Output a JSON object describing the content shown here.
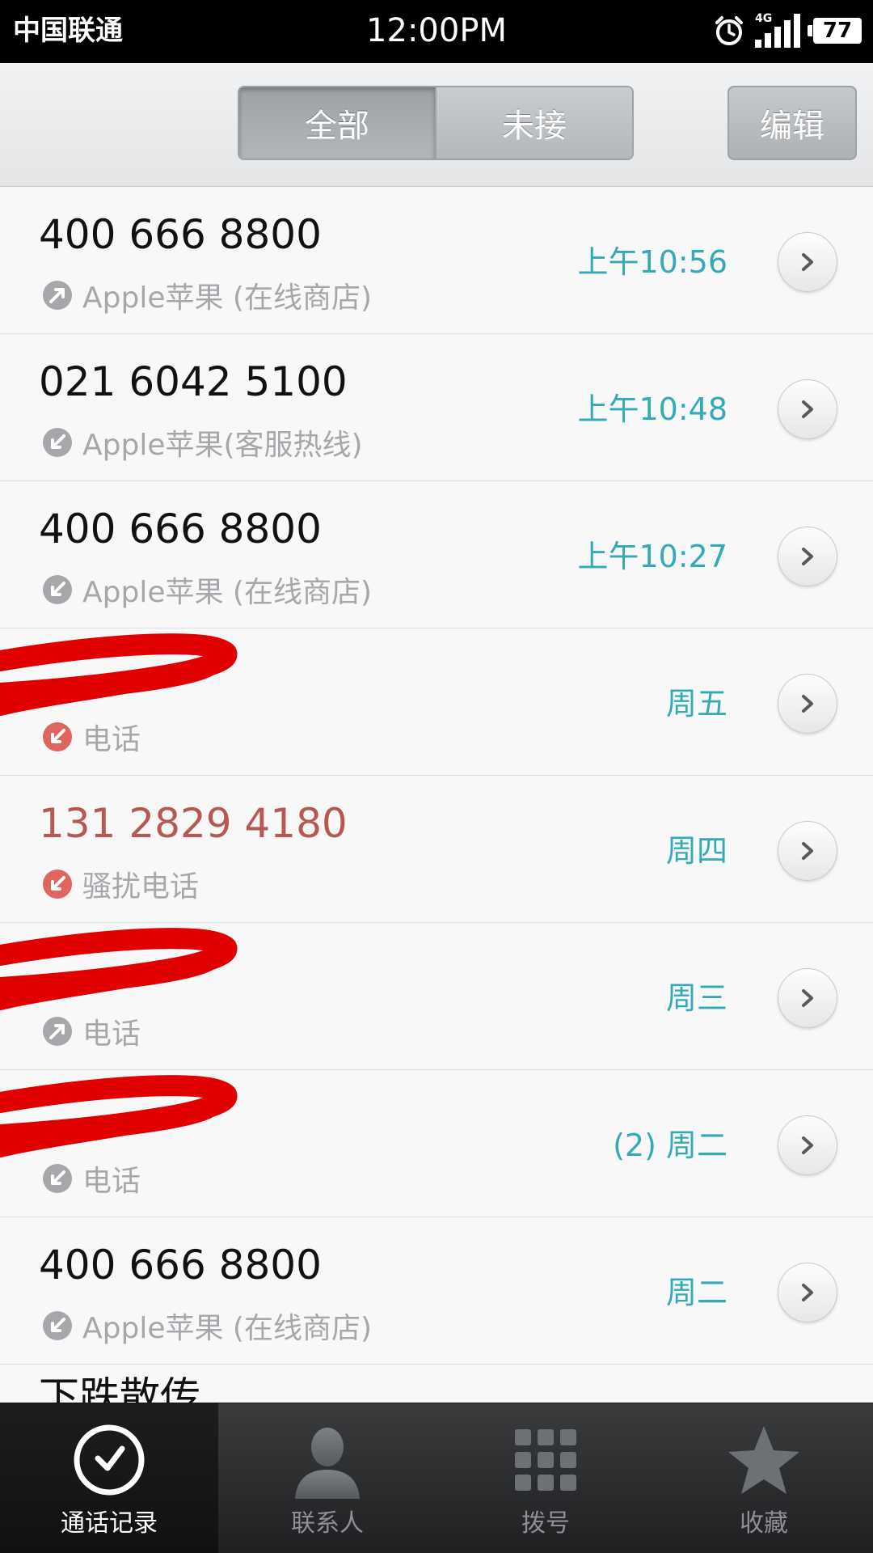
{
  "status_bar": {
    "carrier": "中国联通",
    "time": "12:00PM",
    "network": "4G",
    "battery": "77"
  },
  "header": {
    "segments": [
      "全部",
      "未接"
    ],
    "active_segment": "全部",
    "edit_label": "编辑"
  },
  "calls": [
    {
      "number": "400 666 8800",
      "label": "Apple苹果 (在线商店)",
      "time": "上午10:56",
      "call_type": "outgoing",
      "missed": false
    },
    {
      "number": "021 6042 5100",
      "label": "Apple苹果(客服热线)",
      "time": "上午10:48",
      "call_type": "incoming",
      "missed": false
    },
    {
      "number": "400 666 8800",
      "label": "Apple苹果 (在线商店)",
      "time": "上午10:27",
      "call_type": "incoming",
      "missed": false
    },
    {
      "number": "",
      "label": "电话",
      "time": "周五",
      "call_type": "missed",
      "missed": true,
      "redacted": true
    },
    {
      "number": "131 2829 4180",
      "label": "骚扰电话",
      "time": "周四",
      "call_type": "missed",
      "missed": true
    },
    {
      "number": "",
      "label": "电话",
      "time": "周三",
      "call_type": "outgoing",
      "missed": false,
      "redacted": true
    },
    {
      "number": "",
      "label": "电话",
      "time": "(2) 周二",
      "call_type": "incoming",
      "missed": false,
      "redacted": true
    },
    {
      "number": "400 666 8800",
      "label": "Apple苹果 (在线商店)",
      "time": "周二",
      "call_type": "incoming",
      "missed": false
    },
    {
      "number": "下跌散传",
      "label": "",
      "time": "",
      "call_type": "",
      "missed": false,
      "partial": true
    }
  ],
  "tabs": [
    {
      "label": "通话记录",
      "icon": "clock-icon",
      "active": true
    },
    {
      "label": "联系人",
      "icon": "person-icon",
      "active": false
    },
    {
      "label": "拨号",
      "icon": "keypad-icon",
      "active": false
    },
    {
      "label": "收藏",
      "icon": "star-icon",
      "active": false
    }
  ],
  "colors": {
    "accent_time": "#33aab8",
    "missed_red": "#b75852",
    "icon_gray": "#a5a7aa",
    "icon_red": "#e0655f"
  }
}
